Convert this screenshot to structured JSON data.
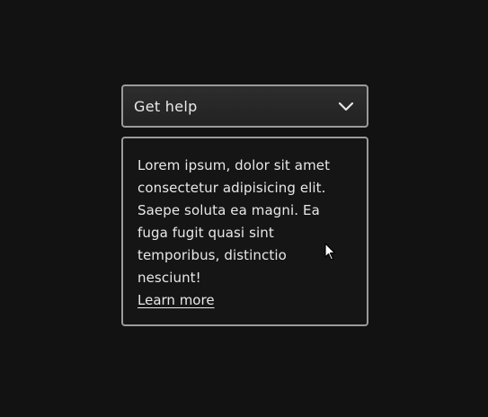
{
  "dropdown": {
    "label": "Get help",
    "icon": "chevron-down-icon"
  },
  "panel": {
    "text": "Lorem ipsum, dolor sit amet consectetur adipisicing elit. Saepe soluta ea magni. Ea fuga fugit quasi sint temporibus, distinctio nesciunt!",
    "link_label": "Learn more"
  },
  "cursor": {
    "icon": "mouse-pointer-icon"
  },
  "colors": {
    "background": "#121212",
    "border": "#9a9a9a",
    "text": "#e8e8e8"
  }
}
